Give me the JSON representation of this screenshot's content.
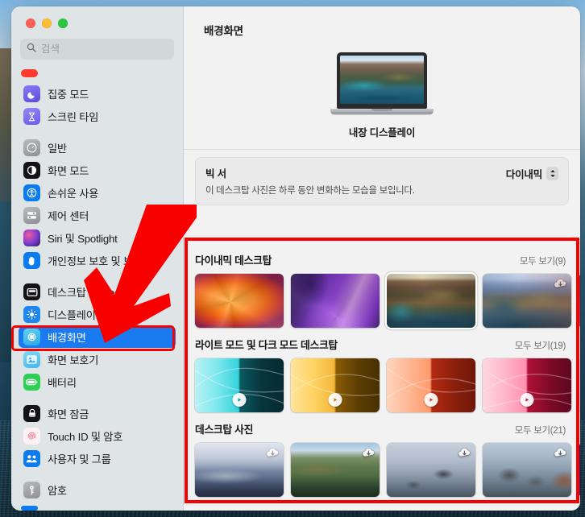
{
  "window": {
    "traffic_lights": [
      "close",
      "minimize",
      "zoom"
    ],
    "colors": {
      "accent": "#1a7af0",
      "annotation": "#f80000",
      "sidebar_bg": "#dfe4e6",
      "main_bg": "#f2f2f2"
    }
  },
  "search": {
    "placeholder": "검색",
    "value": "",
    "icon": "search-icon"
  },
  "sidebar": {
    "items": [
      {
        "label": "집중 모드",
        "icon": "moon-icon",
        "icon_bg": "#6a5ce8",
        "selected": false
      },
      {
        "label": "스크린 타임",
        "icon": "hourglass-icon",
        "icon_bg": "#7a6ef0",
        "selected": false
      },
      {
        "label": "일반",
        "icon": "gear-icon",
        "icon_bg": "#8e8e93",
        "selected": false
      },
      {
        "label": "화면 모드",
        "icon": "appearance-icon",
        "icon_bg": "#1c1c1e",
        "selected": false
      },
      {
        "label": "손쉬운 사용",
        "icon": "accessibility-icon",
        "icon_bg": "#0a84ff",
        "selected": false
      },
      {
        "label": "제어 센터",
        "icon": "control-center-icon",
        "icon_bg": "#8e8e93",
        "selected": false
      },
      {
        "label": "Siri 및 Spotlight",
        "icon": "siri-icon",
        "icon_bg": "#3a2a5a",
        "selected": false
      },
      {
        "label": "개인정보 보호 및 보안",
        "icon": "privacy-hand-icon",
        "icon_bg": "#0a84ff",
        "selected": false
      },
      {
        "label": "데스크탑 및 Dock",
        "icon": "desktop-dock-icon",
        "icon_bg": "#1c1c1e",
        "selected": false
      },
      {
        "label": "디스플레이",
        "icon": "brightness-icon",
        "icon_bg": "#0a84ff",
        "selected": false
      },
      {
        "label": "배경화면",
        "icon": "wallpaper-icon",
        "icon_bg": "#32ade6",
        "selected": true
      },
      {
        "label": "화면 보호기",
        "icon": "screensaver-icon",
        "icon_bg": "#5ac8f5",
        "selected": false
      },
      {
        "label": "배터리",
        "icon": "battery-icon",
        "icon_bg": "#30d158",
        "selected": false
      },
      {
        "label": "화면 잠금",
        "icon": "lock-screen-icon",
        "icon_bg": "#1c1c1e",
        "selected": false
      },
      {
        "label": "Touch ID 및 암호",
        "icon": "touch-id-icon",
        "icon_bg": "#ffffff",
        "selected": false
      },
      {
        "label": "사용자 및 그룹",
        "icon": "users-groups-icon",
        "icon_bg": "#0a84ff",
        "selected": false
      },
      {
        "label": "암호",
        "icon": "key-icon",
        "icon_bg": "#8e8e93",
        "selected": false
      }
    ]
  },
  "main": {
    "title": "배경화면",
    "display_name": "내장 디스플레이",
    "info_card": {
      "title": "빅 서",
      "subtitle": "이 데스크탑 사진은 하루 동안 변화하는 모습을 보입니다.",
      "popup_value": "다이내믹",
      "popup_icon": "chevron-up-down-icon"
    },
    "sections": [
      {
        "title": "다이내믹 데스크탑",
        "show_all": "모두 보기(9)",
        "thumbs": [
          {
            "art": "w-ventura",
            "name": "ventura-wallpaper",
            "selected": false,
            "badge": "none"
          },
          {
            "art": "w-monterey",
            "name": "monterey-wallpaper",
            "selected": false,
            "badge": "none"
          },
          {
            "art": "w-bigsur-day",
            "name": "big-sur-wallpaper",
            "selected": true,
            "badge": "none"
          },
          {
            "art": "w-catalina",
            "name": "catalina-wallpaper",
            "selected": false,
            "badge": "download"
          },
          {
            "art": "w-mojave",
            "name": "mojave-wallpaper",
            "selected": false,
            "badge": "none"
          }
        ]
      },
      {
        "title": "라이트 모드 및 다크 모드 데스크탑",
        "show_all": "모두 보기(19)",
        "thumbs": [
          {
            "art": "w-lm-blue",
            "name": "light-dark-blue-wallpaper",
            "selected": false,
            "badge": "play"
          },
          {
            "art": "w-lm-yellow",
            "name": "light-dark-yellow-wallpaper",
            "selected": false,
            "badge": "play"
          },
          {
            "art": "w-lm-orange",
            "name": "light-dark-orange-wallpaper",
            "selected": false,
            "badge": "play"
          },
          {
            "art": "w-lm-pink",
            "name": "light-dark-pink-wallpaper",
            "selected": false,
            "badge": "play"
          },
          {
            "art": "w-lm-purple",
            "name": "light-dark-purple-wallpaper",
            "selected": false,
            "badge": "none"
          }
        ]
      },
      {
        "title": "데스크탑 사진",
        "show_all": "모두 보기(21)",
        "thumbs": [
          {
            "art": "w-ph-mist",
            "name": "photo-mist-wallpaper",
            "selected": false,
            "badge": "download"
          },
          {
            "art": "w-ph-hills",
            "name": "photo-hills-wallpaper",
            "selected": false,
            "badge": "download"
          },
          {
            "art": "w-ph-sea1",
            "name": "photo-sea-wallpaper",
            "selected": false,
            "badge": "download"
          },
          {
            "art": "w-ph-sea2",
            "name": "photo-coast-wallpaper",
            "selected": false,
            "badge": "download"
          },
          {
            "art": "w-ph-blue",
            "name": "photo-blue-wallpaper",
            "selected": false,
            "badge": "none"
          }
        ]
      }
    ]
  },
  "annotations": {
    "arrow": {
      "shape": "down-left-arrow",
      "color": "#f80000"
    },
    "highlight_sidebar_item": "배경화면",
    "highlight_gallery": "wallpaper-gallery"
  }
}
